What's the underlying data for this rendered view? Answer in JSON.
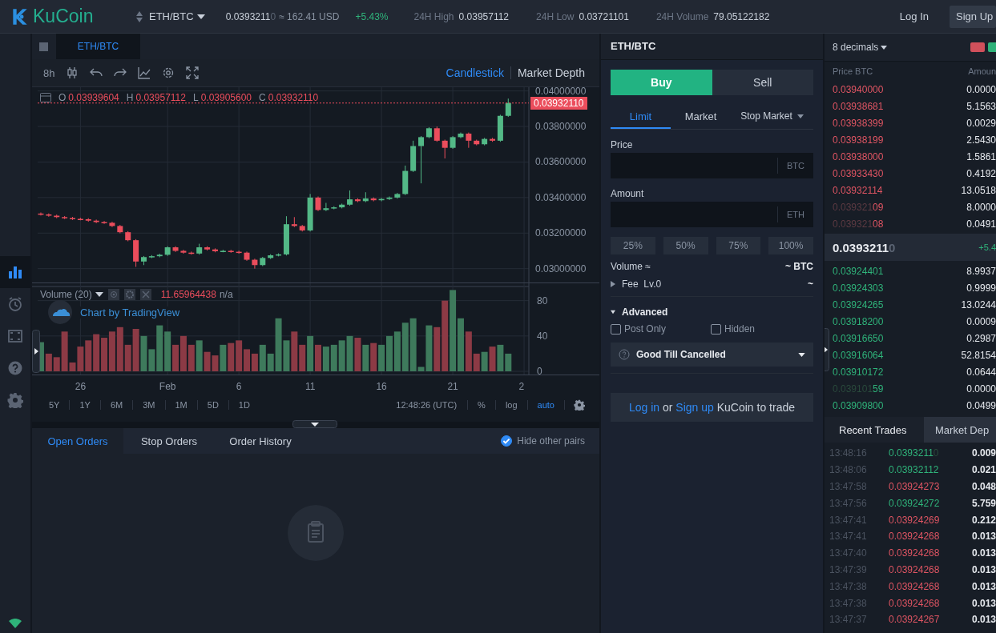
{
  "header": {
    "logo": "KuCoin",
    "pair": "ETH/BTC",
    "price": "0.0393211",
    "price_dim": "0",
    "usd": "≈ 162.41 USD",
    "change": "+5.43%",
    "stats": [
      {
        "label": "24H High",
        "value": "0.03957112"
      },
      {
        "label": "24H Low",
        "value": "0.03721101"
      },
      {
        "label": "24H Volume",
        "value": "79.05122182"
      }
    ],
    "buttons": [
      {
        "label": "Log In",
        "kind": "link"
      },
      {
        "label": "Sign Up",
        "kind": "filled"
      }
    ]
  },
  "sidebar": {
    "items": [
      {
        "kind": "chart",
        "selected": true
      },
      {
        "kind": "alarm",
        "selected": false
      },
      {
        "kind": "frame",
        "selected": false
      },
      {
        "kind": "help",
        "selected": false
      },
      {
        "kind": "gear",
        "selected": false
      }
    ]
  },
  "chart_panel": {
    "tab": "ETH/BTC",
    "interval": "8h",
    "views": [
      {
        "label": "Candlestick",
        "selected": true
      },
      {
        "label": "Market Depth",
        "selected": false
      }
    ],
    "legend": [
      {
        "key": "O",
        "value": "0.03939604"
      },
      {
        "key": "H",
        "value": "0.03957112"
      },
      {
        "key": "L",
        "value": "0.03905600"
      },
      {
        "key": "C",
        "value": "0.03932110"
      }
    ],
    "last_price": "0.03932110",
    "price_chart": {
      "chart_data": {
        "type": "candlestick",
        "grid": true,
        "ylim": [
          0.02931,
          0.04021
        ],
        "categories": [
          null,
          null,
          null,
          null,
          null,
          null,
          null,
          null,
          null,
          null,
          null,
          null,
          null,
          null,
          null,
          null,
          null,
          null,
          null,
          null,
          null,
          null,
          null,
          null,
          null,
          null,
          null,
          null,
          null,
          null,
          null,
          null,
          null,
          null,
          null,
          null,
          null,
          null,
          null,
          null,
          null,
          null,
          null,
          null,
          null,
          null,
          null,
          null,
          null,
          null,
          null,
          null,
          null,
          null,
          null,
          null,
          null,
          null,
          null,
          null
        ],
        "yticks": [
          {
            "value": 0.03,
            "label": "0.03000000"
          },
          {
            "value": 0.032,
            "label": "0.03200000"
          },
          {
            "value": 0.034,
            "label": "0.03400000"
          },
          {
            "value": 0.036,
            "label": "0.03600000"
          },
          {
            "value": 0.038,
            "label": "0.03800000"
          },
          {
            "value": 0.04,
            "label": "0.04000000"
          }
        ],
        "ohlc": [
          [
            0.0331,
            0.03316,
            0.03299,
            0.03305
          ],
          [
            0.03305,
            0.03311,
            0.03292,
            0.03298
          ],
          [
            0.03298,
            0.03304,
            0.03284,
            0.0329
          ],
          [
            0.0329,
            0.03296,
            0.03279,
            0.03285
          ],
          [
            0.03285,
            0.03291,
            0.03274,
            0.0328
          ],
          [
            0.0328,
            0.03286,
            0.03272,
            0.03278
          ],
          [
            0.03278,
            0.03284,
            0.03264,
            0.0327
          ],
          [
            0.0327,
            0.03276,
            0.03256,
            0.03262
          ],
          [
            0.03262,
            0.03268,
            0.03252,
            0.03258
          ],
          [
            0.03258,
            0.03264,
            0.03234,
            0.0324
          ],
          [
            0.0324,
            0.03246,
            0.03199,
            0.03205
          ],
          [
            0.03205,
            0.03211,
            0.03154,
            0.0316
          ],
          [
            0.0316,
            0.03166,
            0.0301,
            0.0304
          ],
          [
            0.0304,
            0.03071,
            0.0302,
            0.03065
          ],
          [
            0.03065,
            0.03076,
            0.03059,
            0.0307
          ],
          [
            0.0307,
            0.03084,
            0.03064,
            0.03078
          ],
          [
            0.03078,
            0.03126,
            0.03072,
            0.0312
          ],
          [
            0.0312,
            0.03126,
            0.03094,
            0.031
          ],
          [
            0.031,
            0.03106,
            0.03084,
            0.0309
          ],
          [
            0.0309,
            0.03096,
            0.03079,
            0.03085
          ],
          [
            0.03085,
            0.0314,
            0.03079,
            0.0312
          ],
          [
            0.0312,
            0.03126,
            0.03102,
            0.03108
          ],
          [
            0.03108,
            0.03114,
            0.03092,
            0.03098
          ],
          [
            0.03098,
            0.03106,
            0.03092,
            0.031
          ],
          [
            0.031,
            0.03106,
            0.03089,
            0.03095
          ],
          [
            0.03095,
            0.03101,
            0.03084,
            0.0309
          ],
          [
            0.0309,
            0.03096,
            0.03044,
            0.0305
          ],
          [
            0.0305,
            0.03056,
            0.03,
            0.0302
          ],
          [
            0.0302,
            0.03066,
            0.03014,
            0.0306
          ],
          [
            0.0306,
            0.03081,
            0.03054,
            0.03075
          ],
          [
            0.03075,
            0.03086,
            0.03069,
            0.0308
          ],
          [
            0.0308,
            0.03295,
            0.03074,
            0.0325
          ],
          [
            0.0325,
            0.0329,
            0.03234,
            0.0324
          ],
          [
            0.0324,
            0.03246,
            0.03209,
            0.03215
          ],
          [
            0.03215,
            0.0342,
            0.03209,
            0.034
          ],
          [
            0.034,
            0.03406,
            0.03324,
            0.0333
          ],
          [
            0.0333,
            0.0337,
            0.03324,
            0.0334
          ],
          [
            0.0334,
            0.03351,
            0.03334,
            0.03345
          ],
          [
            0.03345,
            0.03366,
            0.03339,
            0.0336
          ],
          [
            0.0336,
            0.0344,
            0.03354,
            0.0339
          ],
          [
            0.0339,
            0.03396,
            0.03374,
            0.0338
          ],
          [
            0.0338,
            0.0343,
            0.03374,
            0.03395
          ],
          [
            0.03395,
            0.03401,
            0.03379,
            0.03385
          ],
          [
            0.03385,
            0.03398,
            0.03379,
            0.03392
          ],
          [
            0.03392,
            0.03406,
            0.03386,
            0.034
          ],
          [
            0.034,
            0.03426,
            0.03394,
            0.0342
          ],
          [
            0.0342,
            0.0358,
            0.03414,
            0.0355
          ],
          [
            0.0355,
            0.0372,
            0.03544,
            0.0369
          ],
          [
            0.0369,
            0.03746,
            0.0348,
            0.0374
          ],
          [
            0.0374,
            0.03796,
            0.03734,
            0.0379
          ],
          [
            0.0379,
            0.038,
            0.03714,
            0.0372
          ],
          [
            0.0372,
            0.03726,
            0.0362,
            0.0368
          ],
          [
            0.0368,
            0.03746,
            0.03674,
            0.0374
          ],
          [
            0.0374,
            0.03766,
            0.03734,
            0.0376
          ],
          [
            0.0376,
            0.03766,
            0.0368,
            0.0372
          ],
          [
            0.0372,
            0.03726,
            0.03694,
            0.037
          ],
          [
            0.037,
            0.03736,
            0.03694,
            0.0373
          ],
          [
            0.0373,
            0.03736,
            0.03714,
            0.0372
          ],
          [
            0.0372,
            0.03866,
            0.03714,
            0.0386
          ],
          [
            0.0386,
            0.03957,
            0.03854,
            0.03932
          ]
        ]
      }
    },
    "volume_legend": {
      "title": "Volume (20)",
      "value": "11.65964438",
      "extra": "n/a"
    },
    "attribution": "Chart by TradingView",
    "volume_chart": {
      "chart_data": {
        "type": "bar",
        "grid": true,
        "ylim": [
          0,
          96
        ],
        "yticks": [
          0,
          40,
          80
        ],
        "categories": [
          null,
          null,
          null,
          null,
          null,
          "26",
          null,
          null,
          null,
          null,
          null,
          null,
          null,
          null,
          null,
          null,
          "Feb",
          null,
          null,
          null,
          null,
          null,
          null,
          null,
          null,
          "6",
          null,
          null,
          null,
          null,
          null,
          null,
          null,
          null,
          "11",
          null,
          null,
          null,
          null,
          null,
          null,
          null,
          null,
          "16",
          null,
          null,
          null,
          null,
          null,
          null,
          null,
          null,
          "21",
          null,
          null,
          null,
          null,
          null,
          null,
          null,
          null,
          "2"
        ],
        "series": [
          {
            "color": "#3e7a5c",
            "values": [
              33,
              null,
              null,
              null,
              null,
              null,
              null,
              null,
              null,
              null,
              null,
              null,
              null,
              40,
              25,
              52,
              45,
              null,
              null,
              null,
              35,
              null,
              null,
              30,
              null,
              null,
              null,
              null,
              30,
              20,
              60,
              35,
              null,
              null,
              40,
              null,
              28,
              30,
              35,
              40,
              null,
              30,
              null,
              30,
              40,
              45,
              55,
              60,
              5,
              52,
              null,
              null,
              92,
              60,
              null,
              null,
              22,
              null,
              30,
              20,
              null,
              null
            ]
          },
          {
            "color": "#8c3a45",
            "values": [
              null,
              20,
              16,
              45,
              10,
              28,
              35,
              42,
              38,
              45,
              50,
              30,
              48,
              null,
              null,
              null,
              null,
              30,
              40,
              30,
              null,
              22,
              18,
              null,
              32,
              35,
              25,
              20,
              null,
              null,
              null,
              null,
              45,
              30,
              null,
              30,
              null,
              null,
              null,
              null,
              38,
              null,
              32,
              null,
              null,
              null,
              null,
              null,
              null,
              null,
              50,
              80,
              null,
              null,
              45,
              20,
              null,
              28,
              null,
              null,
              null,
              null
            ]
          }
        ]
      }
    },
    "ranges": [
      "5Y",
      "1Y",
      "6M",
      "3M",
      "1M",
      "5D",
      "1D"
    ],
    "time": "12:48:26 (UTC)",
    "options": [
      {
        "label": "%",
        "selected": false
      },
      {
        "label": "log",
        "selected": false
      },
      {
        "label": "auto",
        "selected": true
      }
    ]
  },
  "orders": {
    "tabs": [
      {
        "label": "Open Orders",
        "selected": true
      },
      {
        "label": "Stop Orders",
        "selected": false
      },
      {
        "label": "Order History",
        "selected": false
      }
    ],
    "hide_other_pairs": {
      "label": "Hide other pairs",
      "checked": true
    }
  },
  "order_form": {
    "title": "ETH/BTC",
    "sides": [
      {
        "label": "Buy",
        "selected": true
      },
      {
        "label": "Sell",
        "selected": false
      }
    ],
    "types": [
      {
        "label": "Limit",
        "selected": true,
        "dropdown": false
      },
      {
        "label": "Market",
        "selected": false,
        "dropdown": false
      },
      {
        "label": "Stop Market",
        "selected": false,
        "dropdown": true
      }
    ],
    "fields": [
      {
        "label": "Price",
        "unit": "BTC"
      },
      {
        "label": "Amount",
        "unit": "ETH"
      }
    ],
    "percents": [
      "25%",
      "50%",
      "75%",
      "100%"
    ],
    "volume": {
      "label": "Volume ≈",
      "value": "~ BTC"
    },
    "fee": {
      "label": "Fee  Lv.0",
      "value": "~"
    },
    "advanced": {
      "label": "Advanced",
      "expanded": true
    },
    "options": [
      {
        "label": "Post Only",
        "checked": false
      },
      {
        "label": "Hidden",
        "checked": false
      }
    ],
    "time_in_force": "Good Till Cancelled",
    "login": {
      "login": "Log in",
      "or": "or",
      "signup": "Sign up",
      "rest": "KuCoin to trade"
    }
  },
  "order_book": {
    "precision": "8 decimals",
    "columns": [
      "Price BTC",
      "Amoun"
    ],
    "asks": [
      {
        "price": "0.03940000",
        "amount": "0.0000"
      },
      {
        "price": "0.03938681",
        "amount": "5.1563"
      },
      {
        "price": "0.03938399",
        "amount": "0.0029"
      },
      {
        "price": "0.03938199",
        "amount": "2.5430"
      },
      {
        "price": "0.03938000",
        "amount": "1.5861"
      },
      {
        "price": "0.03933430",
        "amount": "0.4192"
      },
      {
        "price": "0.03932114",
        "amount": "13.0518"
      },
      {
        "lead": "0.039321",
        "price": "09",
        "amount": "8.0000"
      },
      {
        "lead": "0.039321",
        "price": "08",
        "amount": "0.0491"
      }
    ],
    "mid": {
      "price": "0.0393211",
      "price_dim": "0",
      "change": "+5.4"
    },
    "bids": [
      {
        "price": "0.03924401",
        "amount": "8.9937"
      },
      {
        "price": "0.03924303",
        "amount": "0.9999"
      },
      {
        "price": "0.03924265",
        "amount": "13.0244"
      },
      {
        "price": "0.03918200",
        "amount": "0.0009"
      },
      {
        "price": "0.03916650",
        "amount": "0.2987"
      },
      {
        "price": "0.03916064",
        "amount": "52.8154"
      },
      {
        "price": "0.03910172",
        "amount": "0.0644"
      },
      {
        "lead": "0.039101",
        "price": "59",
        "amount": "0.0000"
      },
      {
        "price": "0.03909800",
        "amount": "0.0499"
      }
    ]
  },
  "trades": {
    "tabs": [
      {
        "label": "Recent Trades",
        "selected": true
      },
      {
        "label": "Market Dep",
        "selected": false
      }
    ],
    "rows": [
      {
        "time": "13:48:16",
        "price": "0.0393211",
        "dim": "0",
        "amount": "0.009",
        "kind": "buy"
      },
      {
        "time": "13:48:06",
        "price": "0.03932112",
        "amount": "0.021",
        "kind": "buy"
      },
      {
        "time": "13:47:58",
        "price": "0.03924273",
        "amount": "0.048",
        "kind": "sell"
      },
      {
        "time": "13:47:56",
        "price": "0.03924272",
        "amount": "5.759",
        "kind": "buy"
      },
      {
        "time": "13:47:41",
        "price": "0.03924269",
        "amount": "0.212",
        "kind": "sell"
      },
      {
        "time": "13:47:41",
        "price": "0.03924268",
        "amount": "0.013",
        "kind": "sell"
      },
      {
        "time": "13:47:40",
        "price": "0.03924268",
        "amount": "0.013",
        "kind": "sell"
      },
      {
        "time": "13:47:39",
        "price": "0.03924268",
        "amount": "0.013",
        "kind": "sell"
      },
      {
        "time": "13:47:38",
        "price": "0.03924268",
        "amount": "0.013",
        "kind": "sell"
      },
      {
        "time": "13:47:38",
        "price": "0.03924268",
        "amount": "0.013",
        "kind": "sell"
      },
      {
        "time": "13:47:37",
        "price": "0.03924267",
        "amount": "0.013",
        "kind": "sell"
      }
    ]
  }
}
